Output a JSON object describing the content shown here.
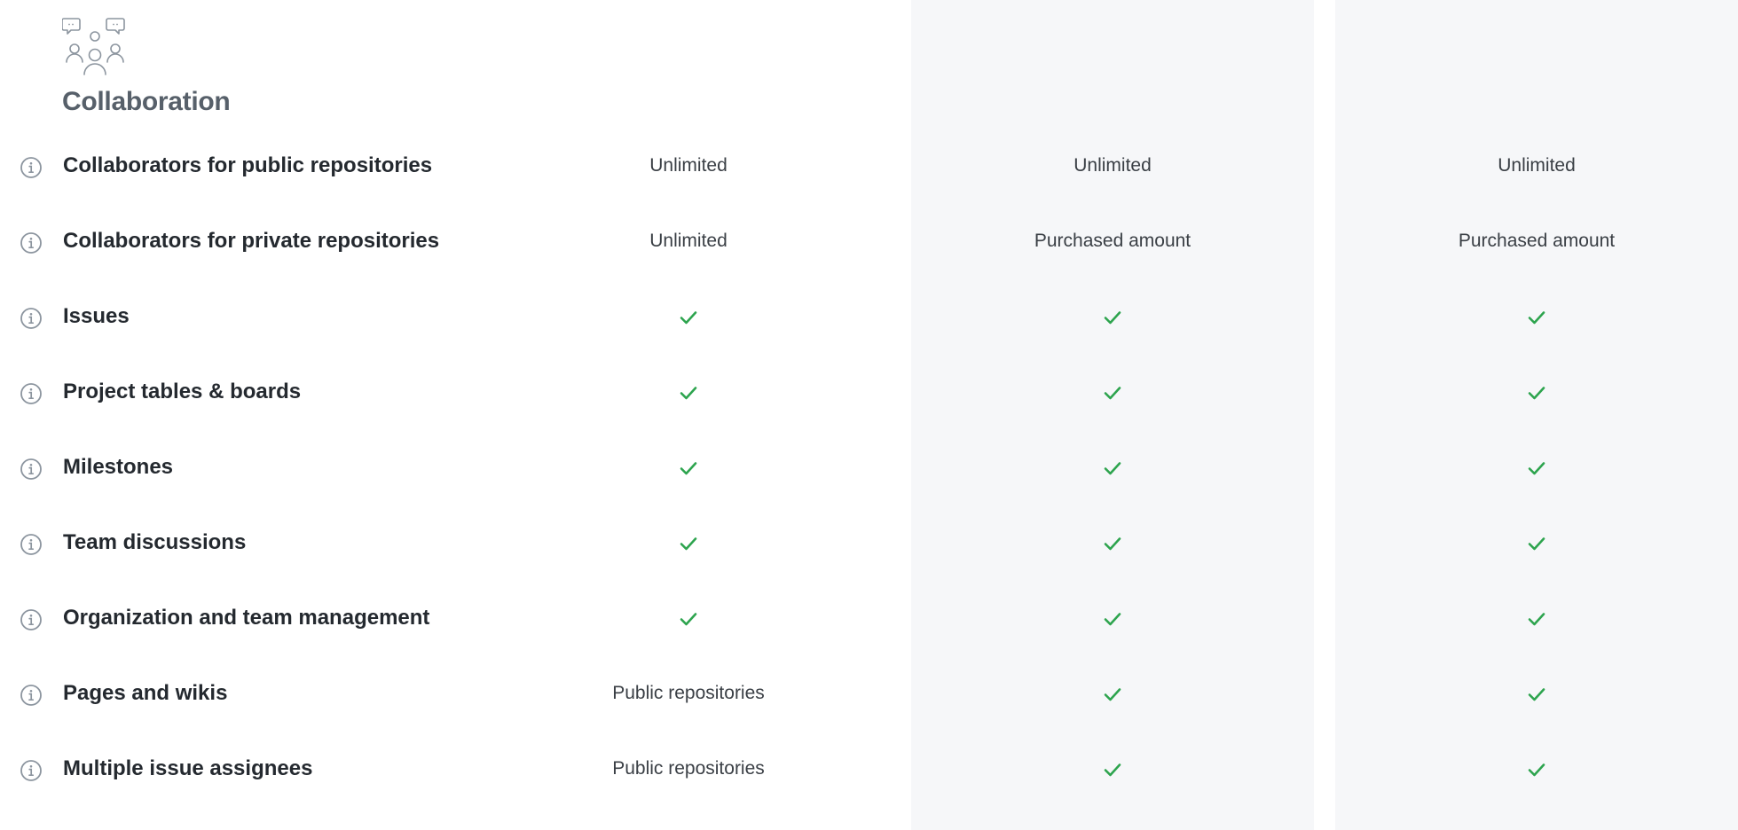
{
  "section": {
    "title": "Collaboration",
    "icon": "people-chat-icon"
  },
  "colors": {
    "check": "#2da44e",
    "plan_column_bg": "#f6f7f9",
    "section_title": "#57606a",
    "info_icon": "#8c959f"
  },
  "features": [
    {
      "name": "Collaborators for public repositories",
      "values": [
        {
          "type": "text",
          "text": "Unlimited"
        },
        {
          "type": "text",
          "text": "Unlimited"
        },
        {
          "type": "text",
          "text": "Unlimited"
        }
      ]
    },
    {
      "name": "Collaborators for private repositories",
      "values": [
        {
          "type": "text",
          "text": "Unlimited"
        },
        {
          "type": "text",
          "text": "Purchased amount"
        },
        {
          "type": "text",
          "text": "Purchased amount"
        }
      ]
    },
    {
      "name": "Issues",
      "values": [
        {
          "type": "check",
          "text": ""
        },
        {
          "type": "check",
          "text": ""
        },
        {
          "type": "check",
          "text": ""
        }
      ]
    },
    {
      "name": "Project tables & boards",
      "values": [
        {
          "type": "check",
          "text": ""
        },
        {
          "type": "check",
          "text": ""
        },
        {
          "type": "check",
          "text": ""
        }
      ]
    },
    {
      "name": "Milestones",
      "values": [
        {
          "type": "check",
          "text": ""
        },
        {
          "type": "check",
          "text": ""
        },
        {
          "type": "check",
          "text": ""
        }
      ]
    },
    {
      "name": "Team discussions",
      "values": [
        {
          "type": "check",
          "text": ""
        },
        {
          "type": "check",
          "text": ""
        },
        {
          "type": "check",
          "text": ""
        }
      ]
    },
    {
      "name": "Organization and team management",
      "values": [
        {
          "type": "check",
          "text": ""
        },
        {
          "type": "check",
          "text": ""
        },
        {
          "type": "check",
          "text": ""
        }
      ]
    },
    {
      "name": "Pages and wikis",
      "values": [
        {
          "type": "text",
          "text": "Public repositories"
        },
        {
          "type": "check",
          "text": ""
        },
        {
          "type": "check",
          "text": ""
        }
      ]
    },
    {
      "name": "Multiple issue assignees",
      "values": [
        {
          "type": "text",
          "text": "Public repositories"
        },
        {
          "type": "check",
          "text": ""
        },
        {
          "type": "check",
          "text": ""
        }
      ]
    }
  ]
}
